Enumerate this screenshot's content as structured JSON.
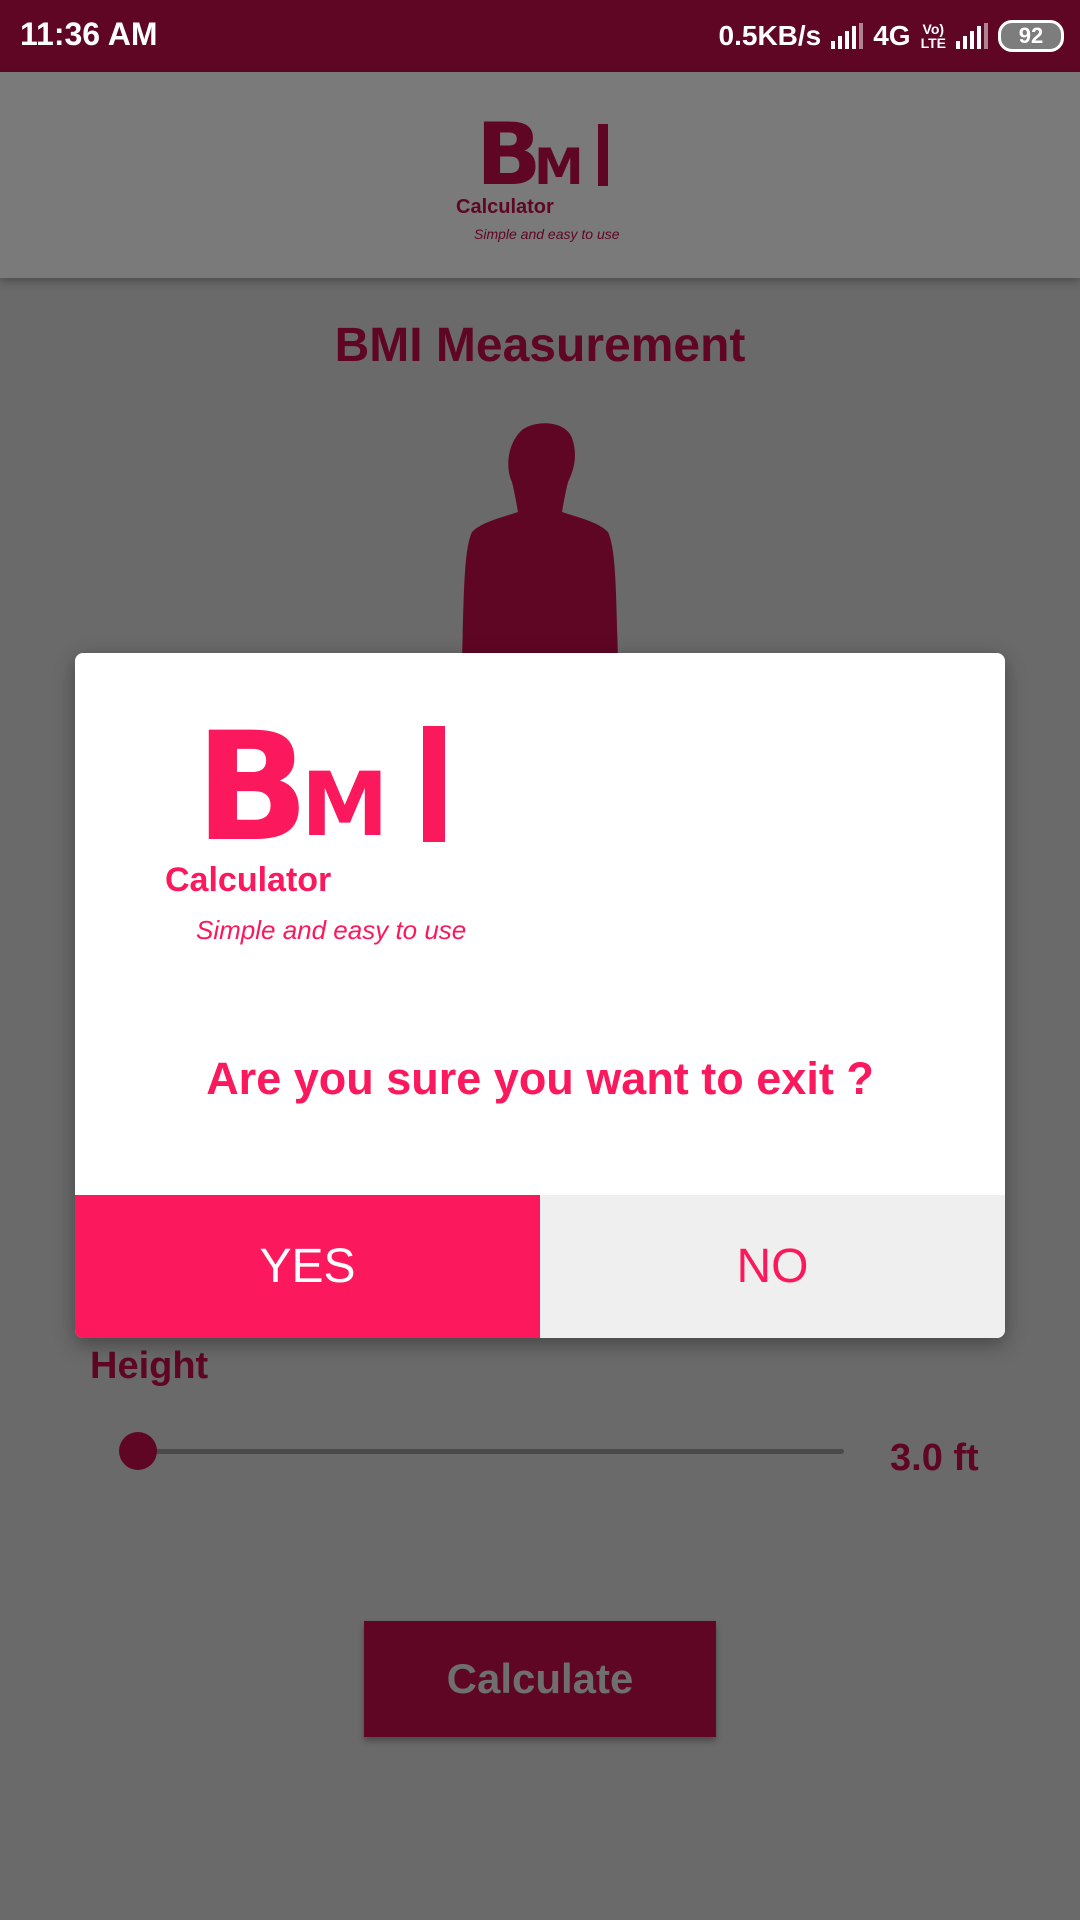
{
  "status_bar": {
    "time": "11:36 AM",
    "speed": "0.5KB/s",
    "network": "4G",
    "volte_top": "Vo)",
    "volte_bottom": "LTE",
    "battery": "92"
  },
  "header": {
    "logo_b": "B",
    "logo_m": "M",
    "logo_i": "I",
    "logo_sub": "Calculator",
    "logo_tagline": "Simple and easy to use"
  },
  "page": {
    "title": "BMI Measurement",
    "height_label": "Height",
    "height_value": "3.0 ft",
    "height_progress": 0.0,
    "calculate_label": "Calculate"
  },
  "dialog": {
    "logo_b": "B",
    "logo_m": "M",
    "logo_i": "I",
    "logo_sub": "Calculator",
    "logo_tagline": "Simple and easy to use",
    "question": "Are you sure you want to exit ?",
    "yes_label": "YES",
    "no_label": "NO"
  },
  "colors": {
    "primary": "#fb185c",
    "primary_dark": "#5f0624",
    "scrim_gray": "#6a6a6a"
  }
}
